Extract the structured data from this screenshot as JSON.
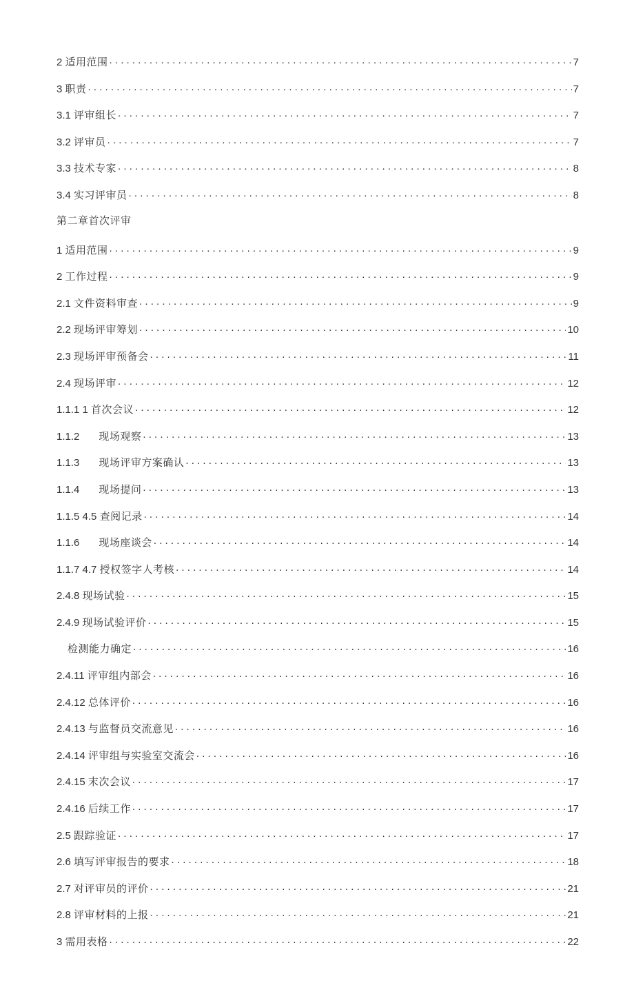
{
  "toc": [
    {
      "indent": 0,
      "prefix_num": "2 ",
      "text_cn": "适用范围",
      "page": "7"
    },
    {
      "indent": 0,
      "prefix_num": "3 ",
      "text_cn": "职责",
      "page": "7"
    },
    {
      "indent": 0,
      "prefix_num": "3.1 ",
      "text_cn": "评审组长",
      "page": "7"
    },
    {
      "indent": 0,
      "prefix_num": "3.2 ",
      "text_cn": "评审员",
      "page": "7"
    },
    {
      "indent": 0,
      "prefix_num": "3.3 ",
      "text_cn": "技术专家",
      "page": "8"
    },
    {
      "indent": 0,
      "prefix_num": "3.4 ",
      "text_cn": "实习评审员",
      "page": "8"
    },
    {
      "indent": 0,
      "prefix_num": "",
      "text_cn": "第二章首次评审",
      "page": null,
      "plain": true
    },
    {
      "indent": 0,
      "prefix_num": "1 ",
      "text_cn": "适用范围",
      "page": "9"
    },
    {
      "indent": 0,
      "prefix_num": "2 ",
      "text_cn": "工作过程",
      "page": "9"
    },
    {
      "indent": 0,
      "prefix_num": "2.1 ",
      "text_cn": "文件资料审查",
      "page": "9"
    },
    {
      "indent": 0,
      "prefix_num": "2.2 ",
      "text_cn": "现场评审筹划",
      "page": "10"
    },
    {
      "indent": 0,
      "prefix_num": "2.3 ",
      "text_cn": "现场评审预备会",
      "page": "11"
    },
    {
      "indent": 0,
      "prefix_num": "2.4 ",
      "text_cn": "现场评审",
      "page": "12"
    },
    {
      "indent": 0,
      "prefix_num": "1.1.1 1 ",
      "text_cn": "首次会议",
      "page": "12"
    },
    {
      "indent": 0,
      "prefix_num": "1.1.2",
      "gap": 28,
      "text_cn": "现场观察",
      "page": "13"
    },
    {
      "indent": 0,
      "prefix_num": "1.1.3",
      "gap": 28,
      "text_cn": "现场评审方案确认",
      "page": "13"
    },
    {
      "indent": 0,
      "prefix_num": "1.1.4",
      "gap": 28,
      "text_cn": "现场提问",
      "page": "13"
    },
    {
      "indent": 0,
      "prefix_num": "1.1.5 4.5 ",
      "text_cn": "查阅记录",
      "page": "14"
    },
    {
      "indent": 0,
      "prefix_num": "1.1.6",
      "gap": 28,
      "text_cn": "现场座谈会 ",
      "page": "14"
    },
    {
      "indent": 0,
      "prefix_num": "1.1.7 4.7 ",
      "text_cn": "授权签字人考核",
      "page": "14"
    },
    {
      "indent": 0,
      "prefix_num": "2.4.8 ",
      "text_cn": "现场试验",
      "page": "15"
    },
    {
      "indent": 0,
      "prefix_num": "2.4.9 ",
      "text_cn": "现场试验评价",
      "page": "15"
    },
    {
      "indent": 16,
      "prefix_num": "",
      "text_cn": "检测能力确定",
      "page": "16"
    },
    {
      "indent": 0,
      "prefix_num": "2.4.11 ",
      "text_cn": "评审组内部会",
      "page": "16"
    },
    {
      "indent": 0,
      "prefix_num": "2.4.12 ",
      "text_cn": "总体评价",
      "page": "16"
    },
    {
      "indent": 0,
      "prefix_num": "2.4.13 ",
      "text_cn": "与监督员交流意见",
      "page": "16"
    },
    {
      "indent": 0,
      "prefix_num": "2.4.14 ",
      "text_cn": "评审组与实验室交流会",
      "page": "16"
    },
    {
      "indent": 0,
      "prefix_num": "2.4.15 ",
      "text_cn": "末次会议",
      "page": "17"
    },
    {
      "indent": 0,
      "prefix_num": "2.4.16 ",
      "text_cn": "后续工作",
      "page": "17"
    },
    {
      "indent": 0,
      "prefix_num": "2.5 ",
      "text_cn": "跟踪验证",
      "page": "17"
    },
    {
      "indent": 0,
      "prefix_num": "2.6 ",
      "text_cn": "填写评审报告的要求",
      "page": "18"
    },
    {
      "indent": 0,
      "prefix_num": "2.7 ",
      "text_cn": "对评审员的评价",
      "page": "21"
    },
    {
      "indent": 0,
      "prefix_num": "2.8 ",
      "text_cn": "评审材料的上报",
      "page": "21"
    },
    {
      "indent": 0,
      "prefix_num": "3 ",
      "text_cn": "需用表格",
      "page": "22"
    }
  ]
}
